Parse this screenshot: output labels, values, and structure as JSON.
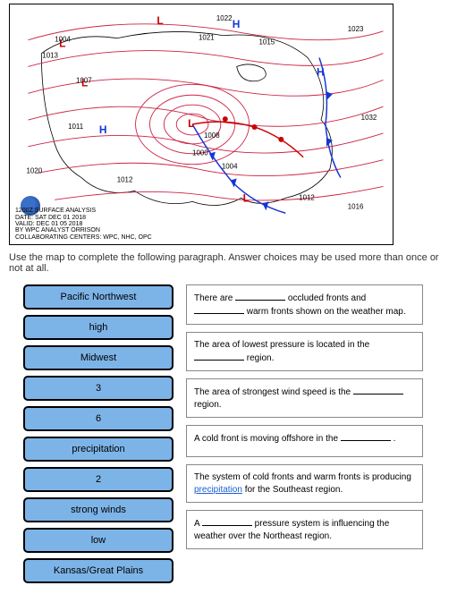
{
  "map": {
    "analysis_line1": "1200Z SURFACE ANALYSIS",
    "analysis_line2": "DATE: SAT DEC 01 2018",
    "analysis_line3": "VALID: DEC 01 05 2018",
    "analysis_line4": "BY WPC ANALYST ORRISON",
    "analysis_line5": "COLLABORATING CENTERS: WPC, NHC, OPC",
    "pressure_labels": [
      "1020",
      "1004",
      "1007",
      "1013",
      "1012",
      "1011",
      "1012",
      "1016",
      "1023",
      "1022",
      "1021",
      "1015",
      "1008",
      "1000",
      "1004",
      "1016",
      "1012",
      "1020",
      "1032"
    ],
    "low_labels": [
      "L",
      "L",
      "L",
      "L",
      "L"
    ],
    "high_labels": [
      "H",
      "H",
      "H"
    ]
  },
  "instructions_text": "Use the map to complete the following paragraph. Answer choices may be used more than once or not at all.",
  "choices": [
    "Pacific Northwest",
    "high",
    "Midwest",
    "3",
    "6",
    "precipitation",
    "2",
    "strong winds",
    "low",
    "Kansas/Great Plains"
  ],
  "sentences": [
    {
      "parts": [
        "There are ",
        "__SLOT__",
        " occluded fronts and ",
        "__SLOT__",
        " warm fronts shown on the weather map."
      ]
    },
    {
      "parts": [
        "The area of lowest pressure is located in the ",
        "__SLOT__",
        " region."
      ]
    },
    {
      "parts": [
        "The area of strongest wind speed is the ",
        "__SLOT__",
        " region."
      ]
    },
    {
      "parts": [
        "A cold front is moving offshore in the ",
        "__SLOT__",
        " ."
      ]
    },
    {
      "parts": [
        "The system of cold fronts and warm fronts is producing ",
        "__LINK__precipitation",
        " for the Southeast region."
      ]
    },
    {
      "parts": [
        "A ",
        "__SLOT__",
        " pressure system is influencing the weather over the Northeast region."
      ]
    }
  ]
}
